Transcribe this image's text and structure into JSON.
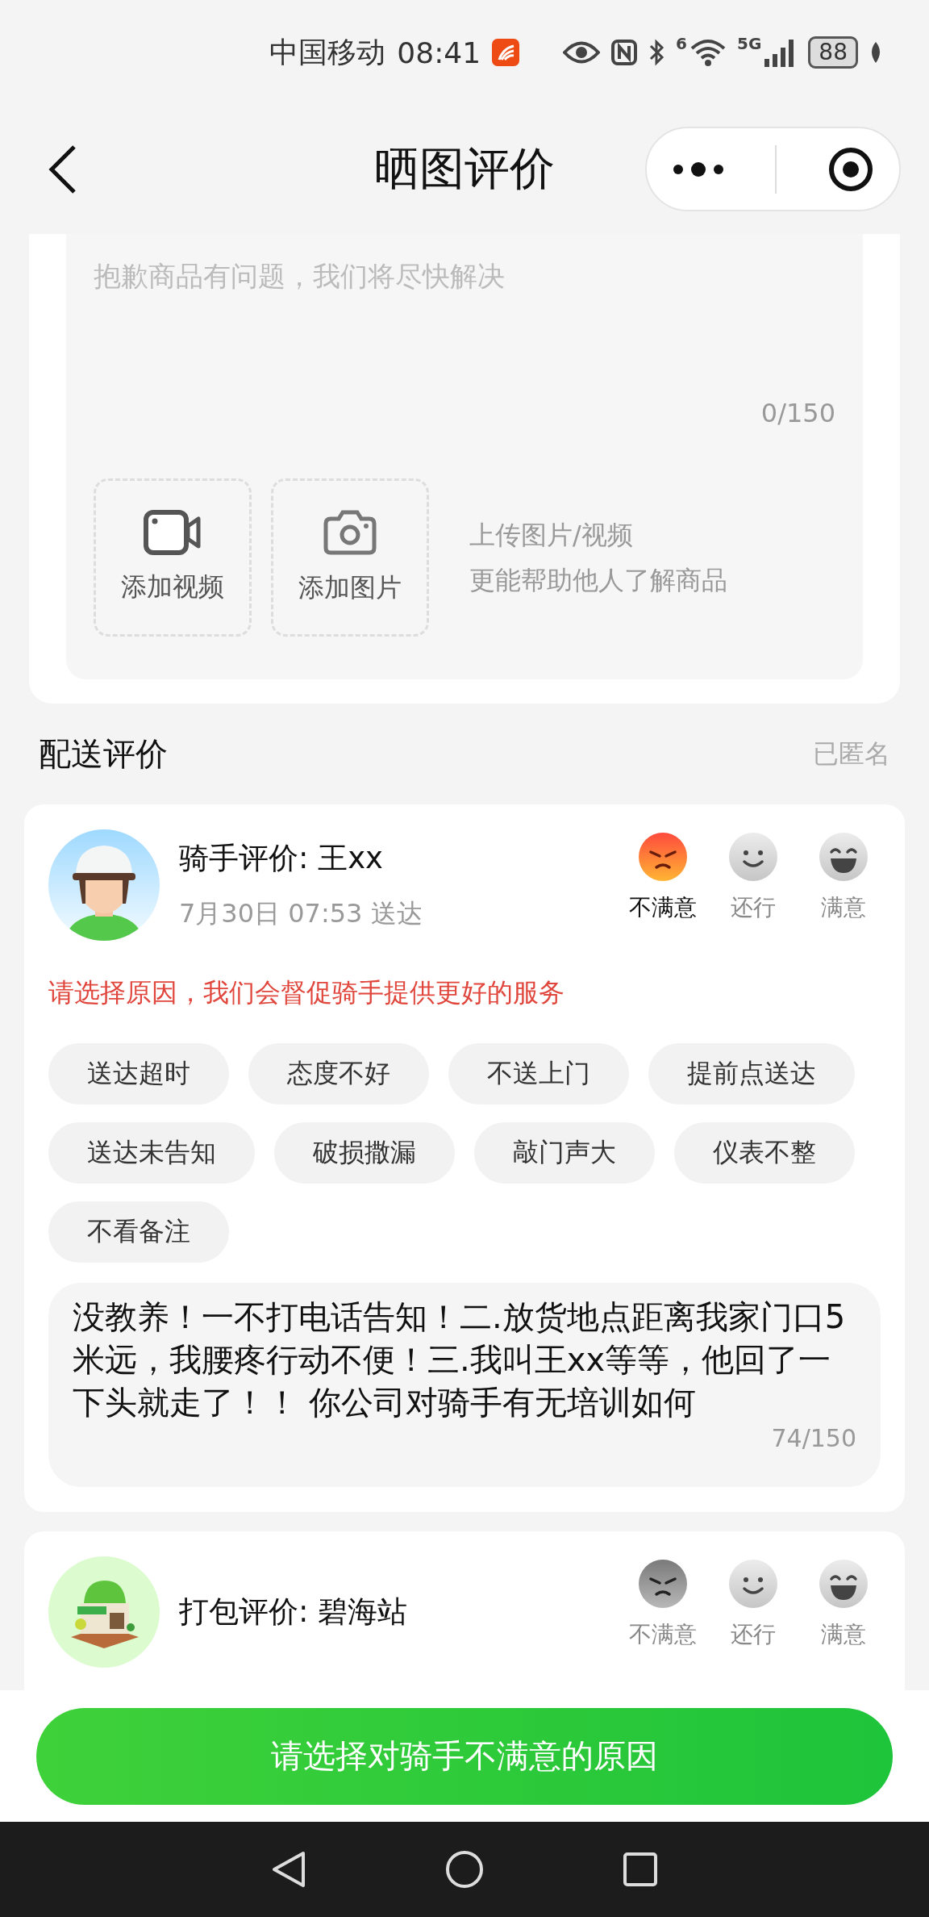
{
  "status_bar": {
    "carrier": "中国移动",
    "time": "08:41",
    "wifi_badge": "6",
    "network": "5G",
    "battery": "88"
  },
  "nav": {
    "title": "晒图评价"
  },
  "review_box": {
    "placeholder": "抱歉商品有问题，我们将尽快解决",
    "counter": "0/150",
    "uploads": [
      {
        "kind": "video",
        "label": "添加视频"
      },
      {
        "kind": "photo",
        "label": "添加图片"
      }
    ],
    "hint": [
      "上传图片/视频",
      "更能帮助他人了解商品"
    ]
  },
  "delivery_section": {
    "title": "配送评价",
    "anonymous": "已匿名"
  },
  "rider_card": {
    "title": "骑手评价: 王xx",
    "subtitle": "7月30日 07:53 送达",
    "ratings": [
      {
        "kind": "bad",
        "label": "不满意",
        "selected": true
      },
      {
        "kind": "ok",
        "label": "还行",
        "selected": false
      },
      {
        "kind": "good",
        "label": "满意",
        "selected": false
      }
    ],
    "prompt": "请选择原因，我们会督促骑手提供更好的服务",
    "reasons": [
      {
        "label": "送达超时",
        "selected": false
      },
      {
        "label": "态度不好",
        "selected": false
      },
      {
        "label": "不送上门",
        "selected": false
      },
      {
        "label": "提前点送达",
        "selected": false
      },
      {
        "label": "送达未告知",
        "selected": false
      },
      {
        "label": "破损撒漏",
        "selected": false
      },
      {
        "label": "敲门声大",
        "selected": false
      },
      {
        "label": "仪表不整",
        "selected": false
      },
      {
        "label": "不看备注",
        "selected": false
      }
    ],
    "comment": "没教养！一不打电话告知！二.放货地点距离我家门口5米远，我腰疼行动不便！三.我叫王xx等等，他回了一下头就走了！！ 你公司对骑手有无培训如何",
    "comment_counter": "74/150"
  },
  "packing_card": {
    "title": "打包评价: 碧海站",
    "ratings": [
      {
        "kind": "bad",
        "label": "不满意",
        "selected": false
      },
      {
        "kind": "ok",
        "label": "还行",
        "selected": false
      },
      {
        "kind": "good",
        "label": "满意",
        "selected": false
      }
    ]
  },
  "submit_button": "请选择对骑手不满意的原因"
}
